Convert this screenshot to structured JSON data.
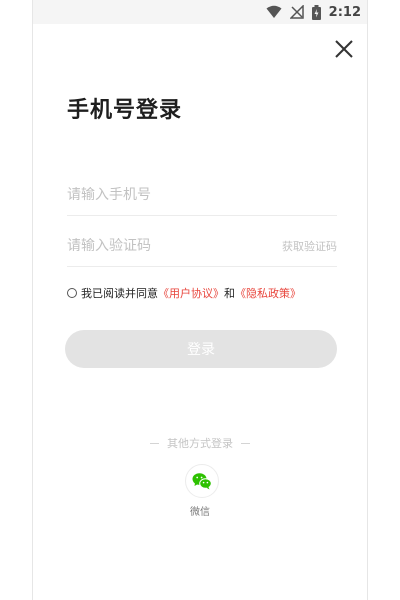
{
  "status_bar": {
    "time": "2:12",
    "icons": [
      "wifi-icon",
      "no-signal-icon",
      "battery-icon"
    ]
  },
  "header": {
    "title": "手机号登录",
    "close_icon": "close-icon"
  },
  "form": {
    "phone_placeholder": "请输入手机号",
    "phone_value": "",
    "code_placeholder": "请输入验证码",
    "code_value": "",
    "get_code_label": "获取验证码"
  },
  "agreement": {
    "prefix": "我已阅读并同意",
    "user_agreement": "《用户协议》",
    "conjunction": "和",
    "privacy_policy": "《隐私政策》"
  },
  "login_button": {
    "label": "登录"
  },
  "other_login": {
    "label": "其他方式登录",
    "wechat_label": "微信"
  },
  "colors": {
    "accent_link": "#e8453c",
    "button_disabled": "#e3e3e3",
    "wechat_green": "#2dc100"
  }
}
